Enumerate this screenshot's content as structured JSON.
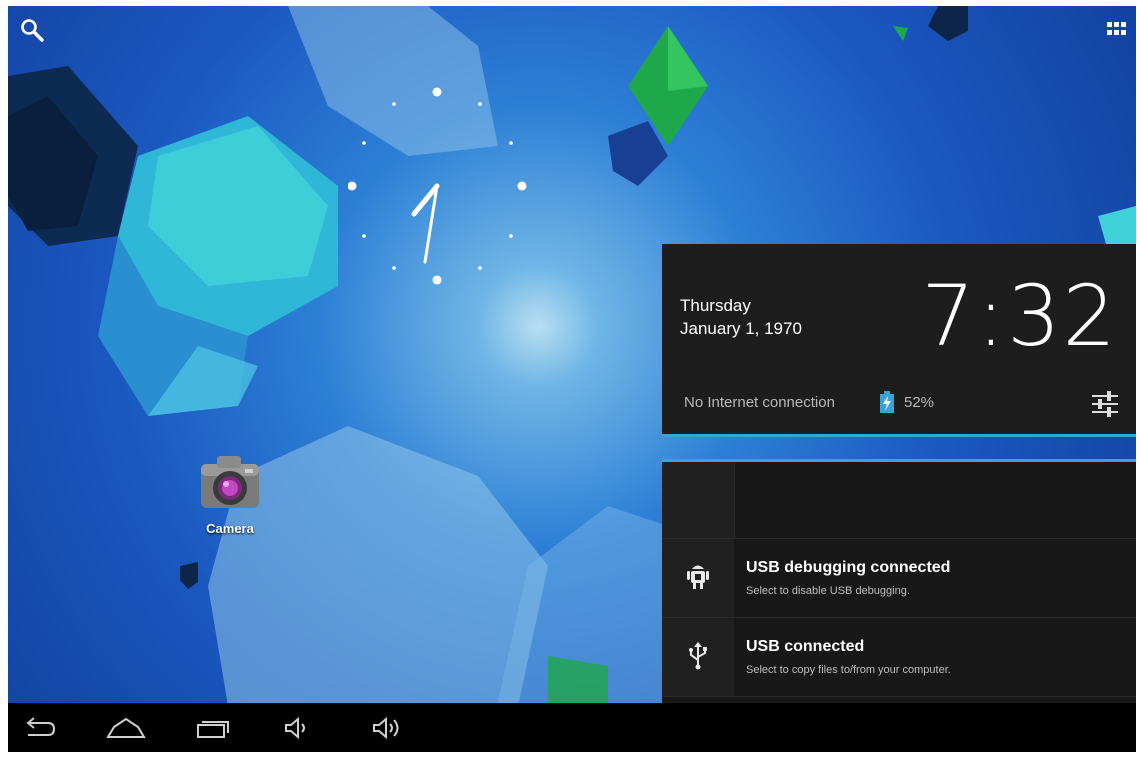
{
  "home": {
    "camera_label": "Camera"
  },
  "status_panel": {
    "day": "Thursday",
    "date": "January 1, 1970",
    "time": "7:32",
    "connection": "No Internet connection",
    "battery": "52%"
  },
  "notifications": [
    {
      "title": "USB debugging connected",
      "subtitle": "Select to disable USB debugging.",
      "icon": "android-debug-icon"
    },
    {
      "title": "USB connected",
      "subtitle": "Select to copy files to/from your computer.",
      "icon": "usb-icon"
    }
  ],
  "navbar": {
    "buttons": [
      "back-icon",
      "home-icon",
      "recent-apps-icon",
      "volume-down-icon",
      "volume-up-icon"
    ]
  },
  "colors": {
    "accent": "#39a3d3",
    "panel": "#1d1d1d"
  }
}
